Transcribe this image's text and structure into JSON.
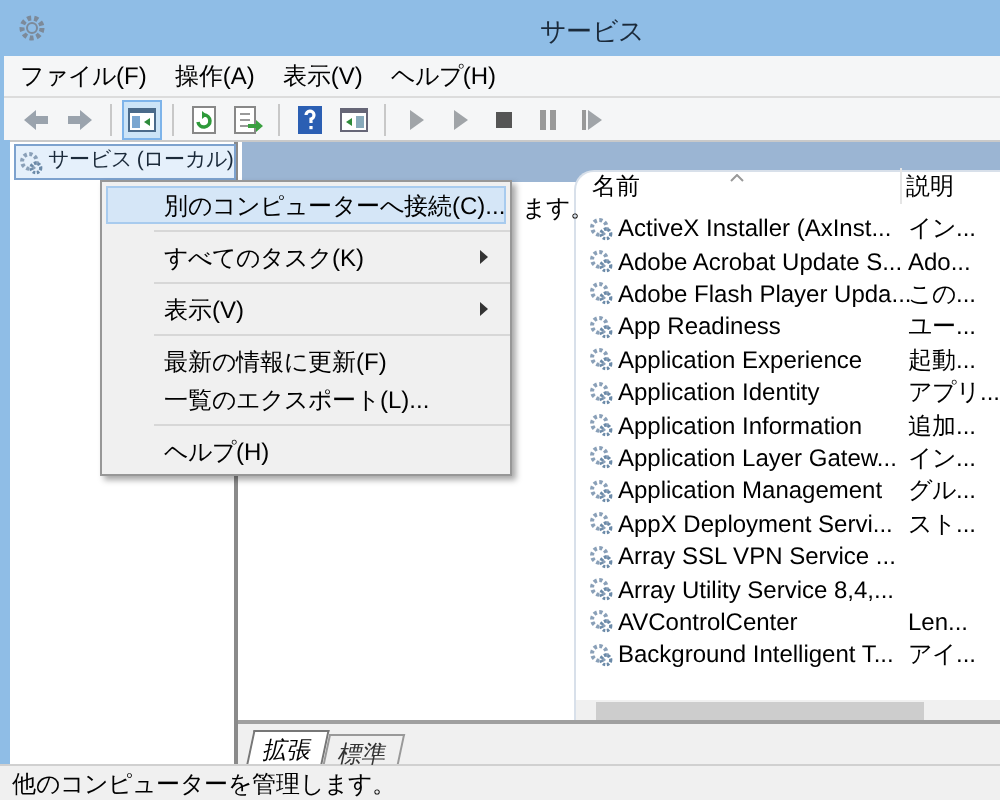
{
  "window": {
    "title": "サービス"
  },
  "menu_bar": [
    "ファイル(F)",
    "操作(A)",
    "表示(V)",
    "ヘルプ(H)"
  ],
  "toolbar": [
    {
      "kind": "back",
      "pressed": false
    },
    {
      "kind": "forward",
      "pressed": false
    },
    {
      "kind": "separator"
    },
    {
      "kind": "tree",
      "pressed": true
    },
    {
      "kind": "separator"
    },
    {
      "kind": "refresh",
      "pressed": false
    },
    {
      "kind": "export",
      "pressed": false
    },
    {
      "kind": "separator"
    },
    {
      "kind": "help",
      "pressed": false
    },
    {
      "kind": "pane",
      "pressed": false
    },
    {
      "kind": "separator"
    },
    {
      "kind": "play",
      "pressed": false
    },
    {
      "kind": "play",
      "pressed": false
    },
    {
      "kind": "stop",
      "pressed": false
    },
    {
      "kind": "pause",
      "pressed": false
    },
    {
      "kind": "resume",
      "pressed": false
    }
  ],
  "tree": [
    {
      "label": "サービス (ローカル)",
      "selected": true
    }
  ],
  "detail_text": "ます。",
  "services": {
    "columns": [
      "名前",
      "説明"
    ],
    "rows": [
      {
        "name": "ActiveX Installer (AxInst...",
        "description": "イン..."
      },
      {
        "name": "Adobe Acrobat Update S...",
        "description": "Ado..."
      },
      {
        "name": "Adobe Flash Player Upda...",
        "description": "この..."
      },
      {
        "name": "App Readiness",
        "description": "ユー..."
      },
      {
        "name": "Application Experience",
        "description": "起動..."
      },
      {
        "name": "Application Identity",
        "description": "アプリ..."
      },
      {
        "name": "Application Information",
        "description": "追加..."
      },
      {
        "name": "Application Layer Gatew...",
        "description": "イン..."
      },
      {
        "name": "Application Management",
        "description": "グル..."
      },
      {
        "name": "AppX Deployment Servi...",
        "description": "スト..."
      },
      {
        "name": "Array SSL VPN Service ..."
      },
      {
        "name": "Array Utility Service 8,4,..."
      },
      {
        "name": "AVControlCenter",
        "description": "Len..."
      },
      {
        "name": "Background Intelligent T...",
        "description": "アイ..."
      }
    ]
  },
  "view_tabs": [
    {
      "label": "拡張",
      "selected": true
    },
    {
      "label": "標準",
      "selected": false
    }
  ],
  "context_menu": [
    {
      "kind": "item",
      "label": "別のコンピューターへ接続(C)...",
      "highlighted": true,
      "submenu": false
    },
    {
      "kind": "separator"
    },
    {
      "kind": "item",
      "label": "すべてのタスク(K)",
      "highlighted": false,
      "submenu": true
    },
    {
      "kind": "separator"
    },
    {
      "kind": "item",
      "label": "表示(V)",
      "highlighted": false,
      "submenu": true
    },
    {
      "kind": "separator"
    },
    {
      "kind": "item",
      "label": "最新の情報に更新(F)",
      "highlighted": false,
      "submenu": false
    },
    {
      "kind": "item",
      "label": "一覧のエクスポート(L)...",
      "highlighted": false,
      "submenu": false
    },
    {
      "kind": "separator"
    },
    {
      "kind": "item",
      "label": "ヘルプ(H)",
      "highlighted": false,
      "submenu": false
    }
  ],
  "status_bar": "他のコンピューターを管理します。"
}
